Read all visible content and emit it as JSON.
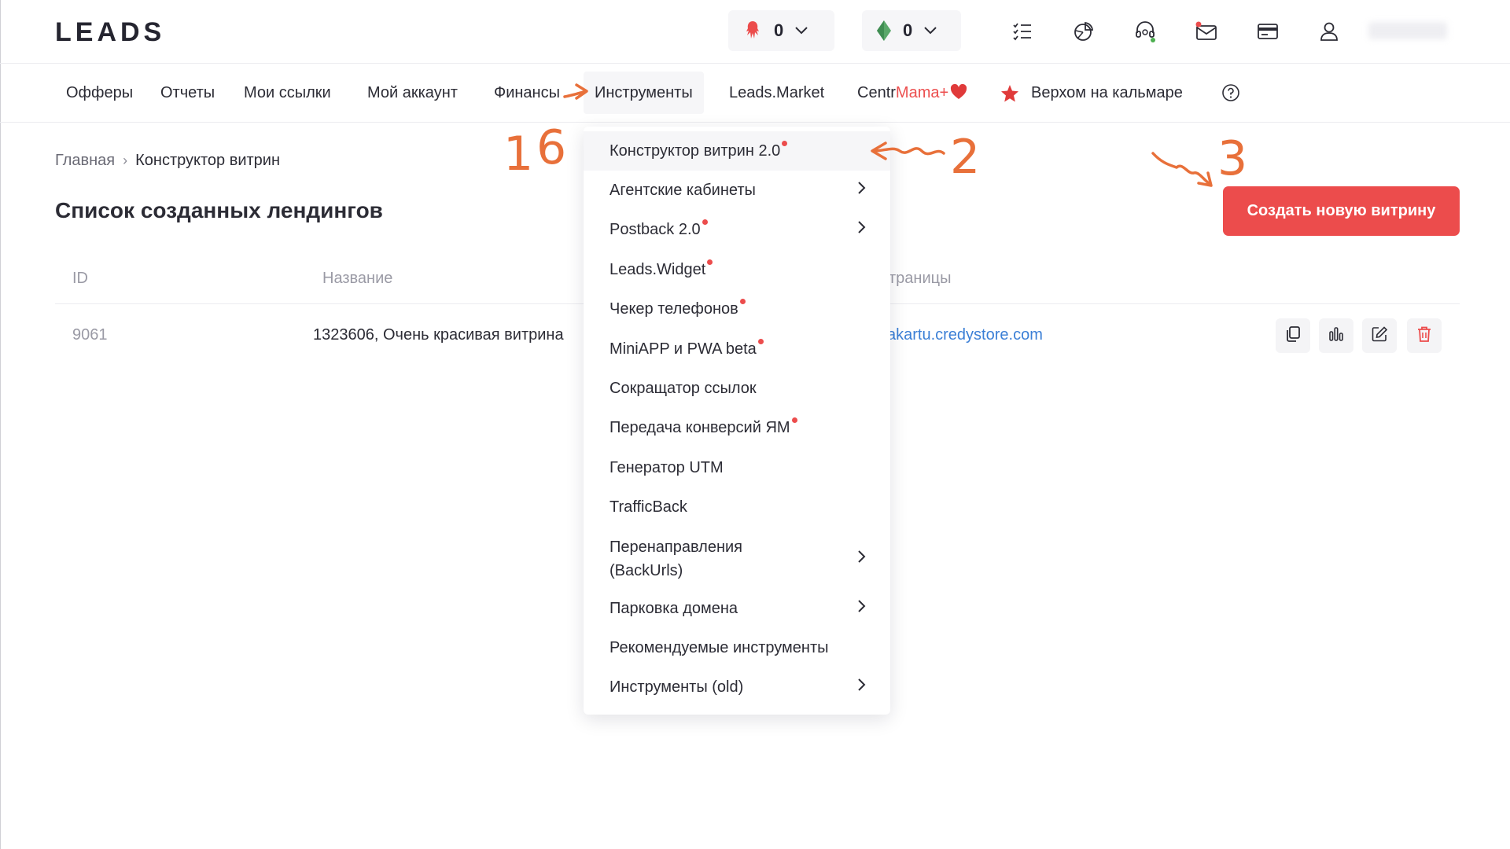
{
  "header": {
    "logo": "LEADS",
    "counter1": "0",
    "counter2": "0"
  },
  "nav": {
    "items": [
      "Офферы",
      "Отчеты",
      "Мои ссылки",
      "Мой аккаунт",
      "Финансы",
      "Инструменты",
      "Leads.Market"
    ],
    "centr": "Centr",
    "mama": "Mama+",
    "special": "Верхом на кальмаре"
  },
  "breadcrumb": {
    "home": "Главная",
    "separator": "›",
    "current": "Конструктор витрин"
  },
  "page": {
    "title": "Список созданных лендингов",
    "create_button": "Создать новую витрину"
  },
  "table": {
    "headers": [
      "ID",
      "Название",
      "траницы"
    ],
    "rows": [
      {
        "id": "9061",
        "name": "1323606, Очень красивая витрина",
        "link": "akartu.credystore.com"
      }
    ]
  },
  "dropdown": {
    "items": [
      {
        "label": "Конструктор витрин 2.0"
      },
      {
        "label": "Агентские кабинеты"
      },
      {
        "label": "Postback 2.0"
      },
      {
        "label": "Leads.Widget"
      },
      {
        "label": "Чекер телефонов"
      },
      {
        "label": "MiniAPP и PWA beta"
      },
      {
        "label": "Сокращатор ссылок"
      },
      {
        "label": "Передача конверсий ЯМ"
      },
      {
        "label": "Генератор UTM"
      },
      {
        "label": "TrafficBack"
      },
      {
        "label": "Перенаправления",
        "label2": "(BackUrls)"
      },
      {
        "label": "Парковка домена"
      },
      {
        "label": "Рекомендуемые инструменты"
      },
      {
        "label": "Инструменты (old)"
      }
    ]
  },
  "annotations": {
    "n1": "1",
    "n2": "2",
    "n3": "3",
    "n6": "6"
  },
  "colors": {
    "accent": "#ec4c4c",
    "link": "#3b7fd6",
    "text": "#2c2c35",
    "muted": "#9a9aa5",
    "annotation": "#e8703a"
  }
}
